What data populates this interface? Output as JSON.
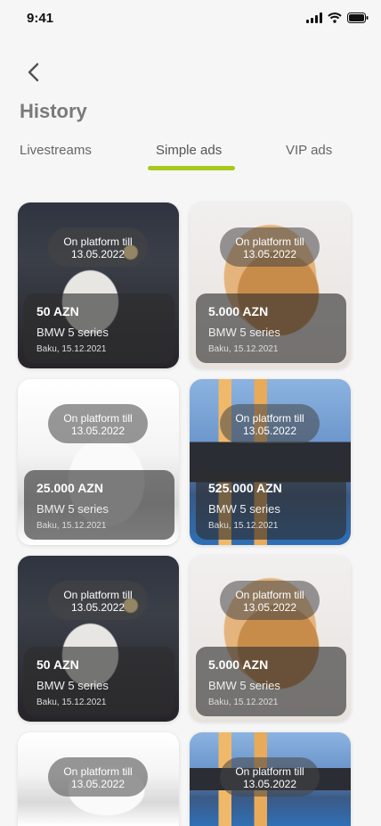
{
  "status": {
    "time": "9:41"
  },
  "header": {
    "title": "History"
  },
  "tabs": [
    {
      "label": "Livestreams"
    },
    {
      "label": "Simple ads",
      "active": true
    },
    {
      "label": "VIP ads"
    }
  ],
  "colors": {
    "accent": "#a8c81c",
    "background": "#f6f6f6",
    "title": "#7a7a7a"
  },
  "icons": {
    "back": "chevron-left-icon",
    "signal": "signal-icon",
    "wifi": "wifi-icon",
    "battery": "battery-icon"
  },
  "cards": [
    {
      "image": "cake",
      "badge_line1": "On platform till",
      "badge_line2": "13.05.2022",
      "price": "50 AZN",
      "name": "BMW 5 series",
      "location": "Baku, 15.12.2021"
    },
    {
      "image": "cat",
      "badge_line1": "On platform till",
      "badge_line2": "13.05.2022",
      "price": "5.000 AZN",
      "name": "BMW 5 series",
      "location": "Baku, 15.12.2021"
    },
    {
      "image": "car",
      "badge_line1": "On platform till",
      "badge_line2": "13.05.2022",
      "price": "25.000 AZN",
      "name": "BMW 5 series",
      "location": "Baku, 15.12.2021"
    },
    {
      "image": "house",
      "badge_line1": "On platform till",
      "badge_line2": "13.05.2022",
      "price": "525.000 AZN",
      "name": "BMW 5 series",
      "location": "Baku, 15.12.2021"
    },
    {
      "image": "cake",
      "badge_line1": "On platform till",
      "badge_line2": "13.05.2022",
      "price": "50 AZN",
      "name": "BMW 5 series",
      "location": "Baku, 15.12.2021"
    },
    {
      "image": "cat",
      "badge_line1": "On platform till",
      "badge_line2": "13.05.2022",
      "price": "5.000 AZN",
      "name": "BMW 5 series",
      "location": "Baku, 15.12.2021"
    },
    {
      "image": "car",
      "badge_line1": "On platform till",
      "badge_line2": "13.05.2022"
    },
    {
      "image": "house",
      "badge_line1": "On platform till",
      "badge_line2": "13.05.2022"
    }
  ]
}
